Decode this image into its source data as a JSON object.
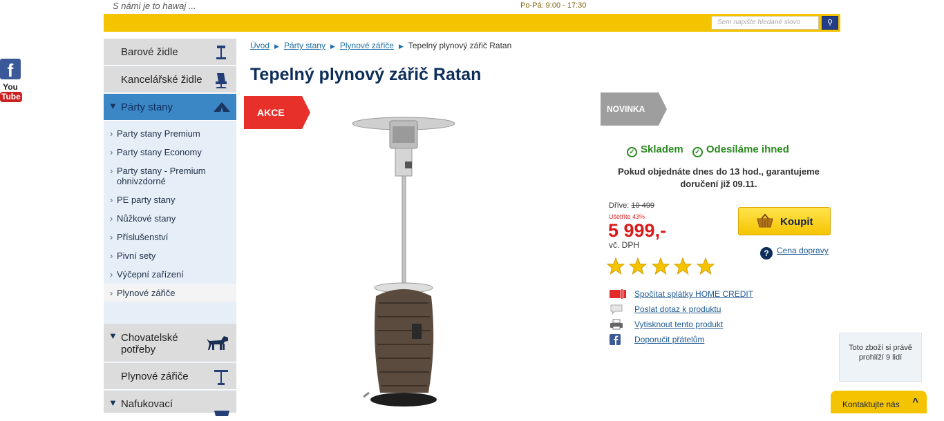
{
  "header": {
    "slogan": "S námi je to hawaj ...",
    "hours": "Po-Pá: 9:00 - 17:30",
    "search_placeholder": "Sem napište hledané slovo",
    "search_button": "🔍"
  },
  "social": {
    "facebook": "f",
    "youtube_top": "You",
    "youtube_bottom": "Tube"
  },
  "sidebar": {
    "categories_top": [
      {
        "label": "Barové židle"
      },
      {
        "label": "Kancelářské židle"
      },
      {
        "label": "Párty stany"
      }
    ],
    "subitems": [
      "Party stany Premium",
      "Party stany Economy",
      "Party stany - Premium ohnivzdorné",
      "PE party stany",
      "Nůžkové stany",
      "Příslušenství",
      "Pivní sety",
      "Výčepní zařízení",
      "Plynové zářiče"
    ],
    "categories_bottom": [
      {
        "label": "Chovatelské potřeby"
      },
      {
        "label": "Plynové zářiče"
      },
      {
        "label": "Nafukovací"
      }
    ]
  },
  "breadcrumb": {
    "items": [
      "Úvod",
      "Párty stany",
      "Plynové zářiče"
    ],
    "current": "Tepelný plynový zářič Ratan"
  },
  "product": {
    "title": "Tepelný plynový zářič Ratan",
    "badge_sale": "AKCE",
    "badge_new": "NOVINKA",
    "in_stock": "Skladem",
    "ships": "Odesíláme ihned",
    "delivery_note": "Pokud objednáte dnes do 13 hod., garantujeme doručení již 09.11.",
    "before_label": "Dříve:",
    "before_price": "10 499",
    "save_label": "Ušetříte 43%",
    "price": "5 999,-",
    "vat": "vč. DPH",
    "buy_label": "Koupit",
    "shipping_link": "Cena dopravy",
    "rating_stars": 5,
    "links": [
      "Spočítat splátky HOME CREDIT",
      "Poslat dotaz k produktu",
      "Vytisknout tento produkt",
      "Doporučit přátelům"
    ]
  },
  "widgets": {
    "viewers": "Toto zboží si právě prohlíží 9 lidí",
    "contact": "Kontaktujte nás",
    "contact_chevron": "^"
  },
  "colors": {
    "accent_yellow": "#f5c400",
    "navy": "#0e2e5a",
    "sale_red": "#e8302a",
    "stock_green": "#2a8a1e"
  }
}
